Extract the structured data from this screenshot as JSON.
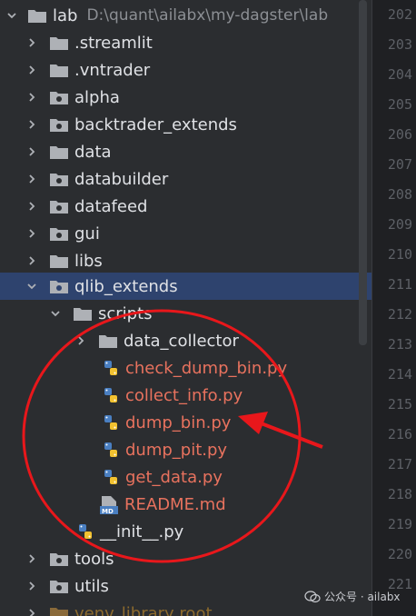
{
  "project": {
    "name": "lab",
    "path": "D:\\quant\\ailabx\\my-dagster\\lab"
  },
  "tree": [
    {
      "label": "lab",
      "kind": "folder",
      "expanded": true
    },
    {
      "label": ".streamlit",
      "kind": "folder"
    },
    {
      "label": ".vntrader",
      "kind": "folder"
    },
    {
      "label": "alpha",
      "kind": "package"
    },
    {
      "label": "backtrader_extends",
      "kind": "package"
    },
    {
      "label": "data",
      "kind": "folder"
    },
    {
      "label": "databuilder",
      "kind": "package"
    },
    {
      "label": "datafeed",
      "kind": "package"
    },
    {
      "label": "gui",
      "kind": "package"
    },
    {
      "label": "libs",
      "kind": "folder"
    },
    {
      "label": "qlib_extends",
      "kind": "package",
      "expanded": true,
      "selected": true
    },
    {
      "label": "scripts",
      "kind": "folder",
      "expanded": true
    },
    {
      "label": "data_collector",
      "kind": "folder"
    },
    {
      "label": "check_dump_bin.py",
      "kind": "python",
      "status": "untracked"
    },
    {
      "label": "collect_info.py",
      "kind": "python",
      "status": "untracked"
    },
    {
      "label": "dump_bin.py",
      "kind": "python",
      "status": "untracked"
    },
    {
      "label": "dump_pit.py",
      "kind": "python",
      "status": "untracked"
    },
    {
      "label": "get_data.py",
      "kind": "python",
      "status": "untracked"
    },
    {
      "label": "README.md",
      "kind": "markdown",
      "status": "untracked"
    },
    {
      "label": "__init__.py",
      "kind": "python"
    },
    {
      "label": "tools",
      "kind": "package"
    },
    {
      "label": "utils",
      "kind": "package"
    },
    {
      "label": "venv",
      "kind": "folder",
      "suffix": "library root"
    }
  ],
  "md_badge": "MD",
  "gutter_lines": [
    "202",
    "203",
    "204",
    "205",
    "206",
    "207",
    "208",
    "209",
    "210",
    "211",
    "212",
    "213",
    "214",
    "215",
    "216",
    "217",
    "218",
    "219",
    "220",
    "221"
  ],
  "annotation": {
    "color": "#e8171b"
  },
  "watermark": {
    "text": "公众号 · ailabx"
  },
  "colors": {
    "selected_row": "#2e436e",
    "untracked_text": "#e8725e",
    "text": "#dfe1e5"
  }
}
